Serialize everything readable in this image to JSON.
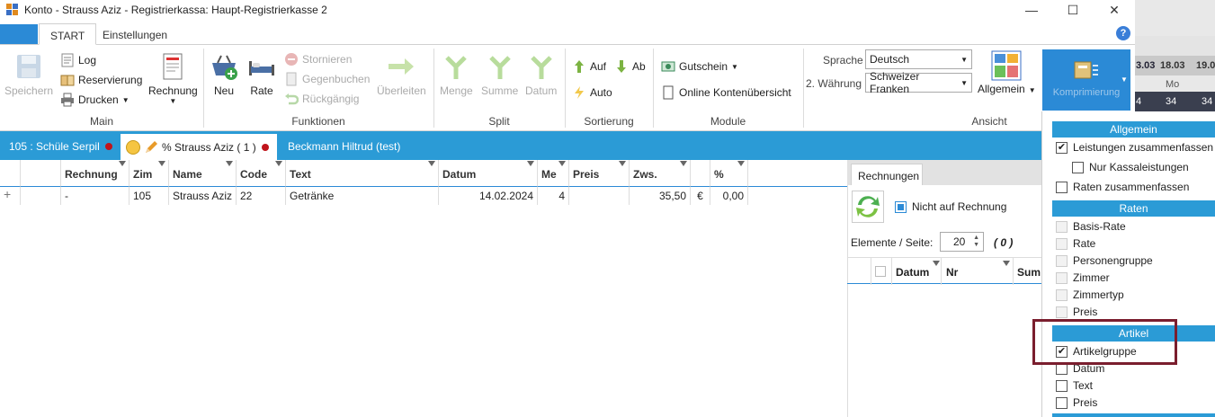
{
  "window": {
    "title": "Konto - Strauss Aziz - Registrierkassa: Haupt-Registrierkasse 2"
  },
  "ribbon_tabs": [
    "START",
    "Einstellungen"
  ],
  "calendar_strip": {
    "dates": [
      "3.03",
      "18.03",
      "19.0"
    ],
    "bottom": [
      "4",
      "34",
      "34"
    ],
    "mid": "Mo"
  },
  "groups": {
    "main": {
      "label": "Main",
      "speichern": "Speichern",
      "log": "Log",
      "reservierung": "Reservierung",
      "drucken": "Drucken",
      "rechnung": "Rechnung"
    },
    "funktionen": {
      "label": "Funktionen",
      "neu": "Neu",
      "rate": "Rate",
      "stornieren": "Stornieren",
      "gegenbuchen": "Gegenbuchen",
      "rueckgaengig": "Rückgängig",
      "ueberleiten": "Überleiten"
    },
    "split": {
      "label": "Split",
      "menge": "Menge",
      "summe": "Summe",
      "datum": "Datum"
    },
    "sortierung": {
      "label": "Sortierung",
      "auf": "Auf",
      "ab": "Ab",
      "auto": "Auto"
    },
    "module": {
      "label": "Module",
      "gutschein": "Gutschein",
      "online": "Online Kontenübersicht"
    },
    "ansicht": {
      "label": "Ansicht",
      "sprache_label": "Sprache",
      "sprache_value": "Deutsch",
      "waehrung_label": "2. Währung",
      "waehrung_value": "Schweizer Franken",
      "allgemein": "Allgemein",
      "komprimierung": "Komprimierung"
    }
  },
  "accounts": [
    {
      "label": "105 :  Schüle Serpil"
    },
    {
      "label": "% Strauss Aziz ( 1 )"
    },
    {
      "label": "Beckmann Hiltrud (test)"
    }
  ],
  "grid": {
    "columns": [
      "Rechnung",
      "Zim",
      "Name",
      "Code",
      "Text",
      "Datum",
      "Me",
      "Preis",
      "Zws.",
      "%"
    ],
    "row": {
      "expander": "+",
      "rechnung": "-",
      "zim": "105",
      "name": "Strauss Aziz",
      "code": "22",
      "text": "Getränke",
      "datum": "14.02.2024",
      "me": "4",
      "preis": "",
      "zws": "35,50",
      "currency": "€",
      "pct": "0,00"
    }
  },
  "rechnungen": {
    "tab": "Rechnungen",
    "nicht_auf_rechnung": "Nicht auf Rechnung",
    "elemente_label": "Elemente / Seite:",
    "elemente_value": "20",
    "count": "( 0 )",
    "columns": [
      "Datum",
      "Nr",
      "Sum"
    ]
  },
  "dropdown": {
    "allgemein": {
      "title": "Allgemein",
      "items": [
        "Leistungen zusammenfassen",
        "Nur Kassaleistungen",
        "Raten zusammenfassen"
      ]
    },
    "raten": {
      "title": "Raten",
      "items": [
        "Basis-Rate",
        "Rate",
        "Personengruppe",
        "Zimmer",
        "Zimmertyp",
        "Preis"
      ]
    },
    "artikel": {
      "title": "Artikel",
      "items": [
        "Artikelgruppe",
        "Datum",
        "Text",
        "Preis"
      ]
    }
  },
  "colors": {
    "accent": "#2b8ad6",
    "tabbar": "#2b9bd6",
    "highlight": "#7a1e2e",
    "dot": "#c0141b"
  }
}
